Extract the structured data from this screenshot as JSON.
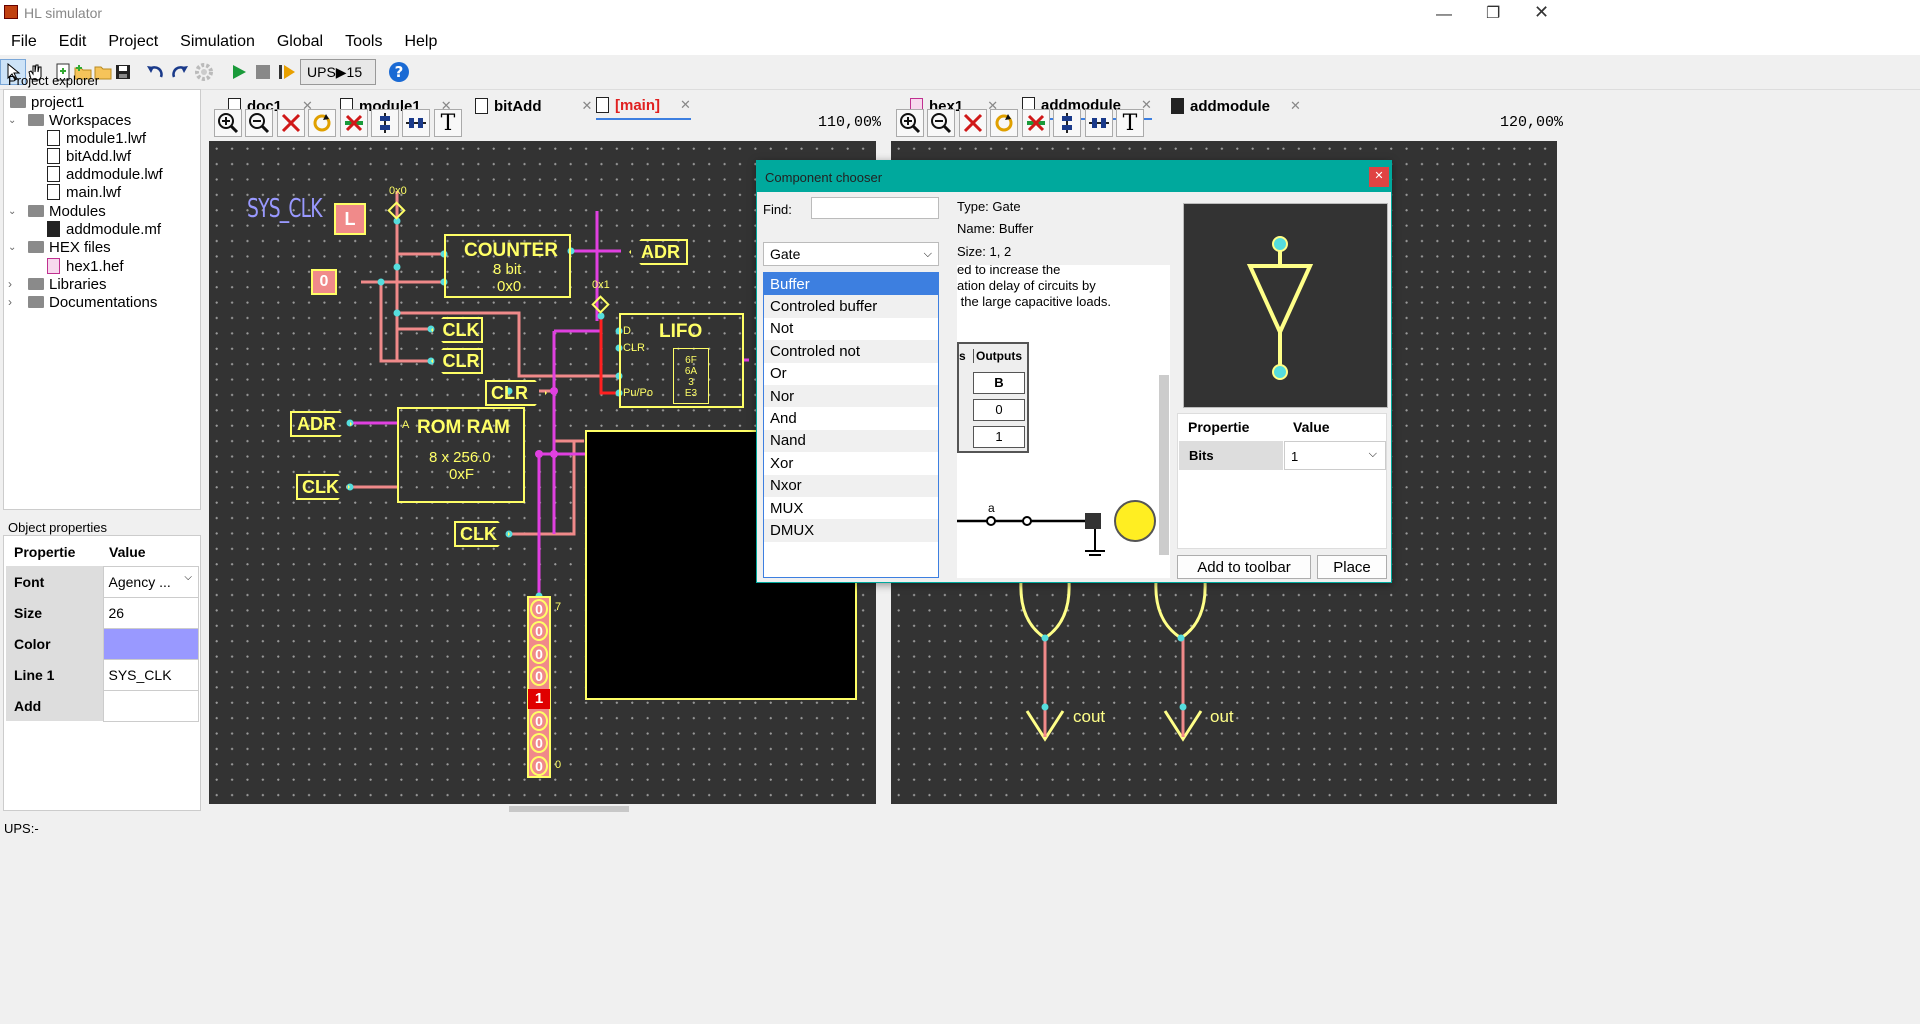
{
  "window": {
    "title": "HL simulator"
  },
  "menu": [
    "File",
    "Edit",
    "Project",
    "Simulation",
    "Global",
    "Tools",
    "Help"
  ],
  "toolbar": {
    "ups_label": "UPS▶15"
  },
  "explorer": {
    "title": "Project explorer",
    "items": [
      {
        "label": "project1"
      },
      {
        "label": "Workspaces"
      },
      {
        "label": "module1.lwf"
      },
      {
        "label": "bitAdd.lwf"
      },
      {
        "label": "addmodule.lwf"
      },
      {
        "label": "main.lwf"
      },
      {
        "label": "Modules"
      },
      {
        "label": "addmodule.mf"
      },
      {
        "label": "HEX files"
      },
      {
        "label": "hex1.hef"
      },
      {
        "label": "Libraries"
      },
      {
        "label": "Documentations"
      }
    ]
  },
  "object_props": {
    "title": "Object properties",
    "header": {
      "prop": "Propertie",
      "value": "Value"
    },
    "rows": [
      {
        "prop": "Font",
        "value": "Agency ..."
      },
      {
        "prop": "Size",
        "value": "26"
      },
      {
        "prop": "Color",
        "value": ""
      },
      {
        "prop": "Line 1",
        "value": "SYS_CLK"
      },
      {
        "prop": "Add",
        "value": ""
      }
    ],
    "color_swatch": "#9999ff"
  },
  "left_tabs": [
    {
      "label": "doc1"
    },
    {
      "label": "module1"
    },
    {
      "label": "bitAdd"
    },
    {
      "label": "[main]"
    }
  ],
  "right_tabs": [
    {
      "label": "hex1"
    },
    {
      "label": "addmodule"
    },
    {
      "label": "addmodule"
    }
  ],
  "zoom": {
    "left": "110,00%",
    "right": "120,00%"
  },
  "circuit": {
    "sys_clk": "SYS_CLK",
    "clk_value": "L",
    "zero_value": "0",
    "probe1": "0x0",
    "probe2": "0x1",
    "counter": {
      "title": "COUNTER",
      "line1": "8 bit",
      "line2": "0x0"
    },
    "adr_out": "ADR",
    "clk1": "CLK",
    "clr1": "CLR",
    "lifo": {
      "title": "LIFO",
      "d": "D",
      "clr": "CLR",
      "pupo": "Pu/Po",
      "stack": [
        "6F",
        "6A",
        "3",
        "E3"
      ]
    },
    "clr2": "CLR",
    "adr_in": "ADR",
    "rom": {
      "title": "ROM RAM",
      "a": "A",
      "line1": "8 x 256.0",
      "line2": "0xF"
    },
    "clk2": "CLK",
    "clk3": "CLK",
    "bits": [
      "0",
      "0",
      "0",
      "0",
      "1",
      "0",
      "0",
      "0"
    ],
    "bit_hi": "7",
    "bit_lo": "0",
    "cout": "cout",
    "out": "out"
  },
  "chooser": {
    "title": "Component chooser",
    "find_label": "Find:",
    "find_value": "",
    "category": "Gate",
    "items": [
      "Buffer",
      "Controled buffer",
      "Not",
      "Controled not",
      "Or",
      "Nor",
      "And",
      "Nand",
      "Xor",
      "Nxor",
      "MUX",
      "DMUX"
    ],
    "selected": "Buffer",
    "type": "Type: Gate",
    "name": "Name: Buffer",
    "size": "Size: 1, 2",
    "desc": [
      "ed to increase the",
      "ation delay of circuits by",
      " the large capacitive loads."
    ],
    "truth": {
      "h1": "s",
      "h2": "Outputs",
      "col": "B",
      "v1": "0",
      "v2": "1"
    },
    "wire_label": "a",
    "props_header": {
      "prop": "Propertie",
      "value": "Value"
    },
    "props": [
      {
        "prop": "Bits",
        "value": "1"
      }
    ],
    "add_button": "Add to toolbar",
    "place_button": "Place"
  },
  "status": "UPS:-",
  "colors": {
    "accent": "#00a99d",
    "wire_pink": "#f08a8a",
    "wire_magenta": "#e040e0",
    "comp_yellow": "#ffff66",
    "select_blue": "#3d7fe0"
  }
}
